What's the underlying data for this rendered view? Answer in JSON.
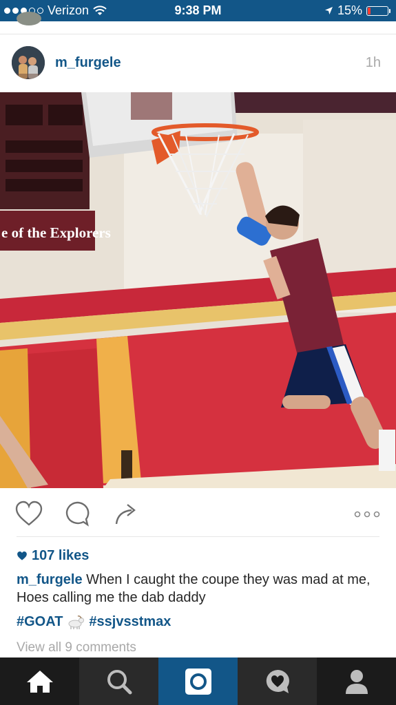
{
  "status_bar": {
    "carrier": "Verizon",
    "time": "9:38 PM",
    "battery_percent": "15%",
    "battery_level": 0.15,
    "signal_bars": 3,
    "signal_max": 5
  },
  "post": {
    "username": "m_furgele",
    "time_ago": "1h",
    "photo_sign_text": "e of the Explorers",
    "likes": "107 likes",
    "caption_username": "m_furgele",
    "caption_text": " When I caught the coupe they was mad at me, Hoes calling me the dab daddy",
    "hashtags": [
      "#GOAT",
      "#ssjvsstmax"
    ],
    "view_comments": "View all 9 comments"
  },
  "icons": {
    "like": "heart-icon",
    "comment": "comment-icon",
    "share": "share-arrow-icon",
    "more": "more-dots-icon",
    "goat": "goat-emoji-icon"
  },
  "tabbar": {
    "tabs": [
      "home-icon",
      "search-icon",
      "camera-icon",
      "activity-icon",
      "profile-icon"
    ],
    "active_index": 2
  },
  "colors": {
    "accent": "#125688",
    "tabbar_bg": "#1b1b1b",
    "muted_text": "#a8a8a8",
    "battery_low": "#ff3b30"
  }
}
